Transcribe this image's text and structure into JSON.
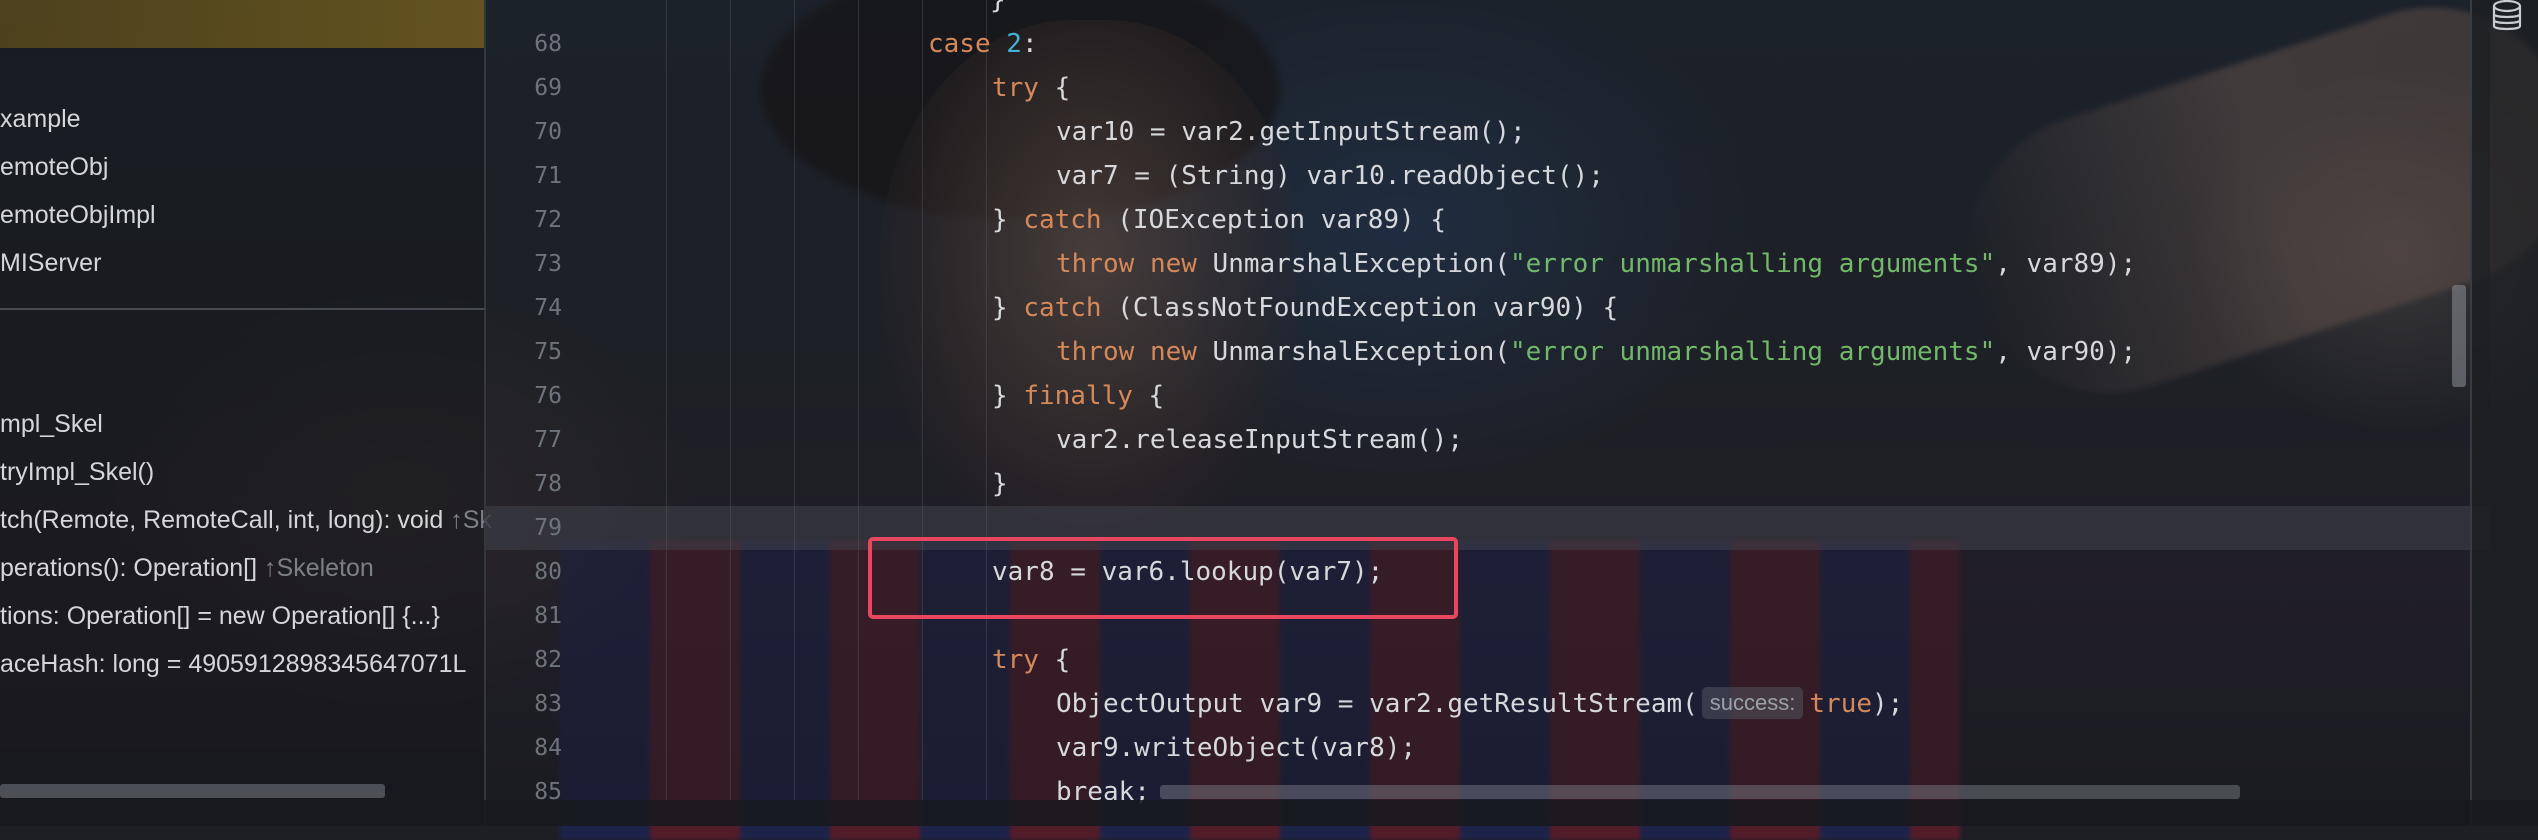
{
  "project_tree": {
    "items": [
      {
        "label": "xample"
      },
      {
        "label": "emoteObj"
      },
      {
        "label": "emoteObjImpl"
      },
      {
        "label": "MIServer"
      },
      {
        "label": "mpl_Skel"
      },
      {
        "label": "tryImpl_Skel()"
      },
      {
        "label": "tch(Remote, RemoteCall, int, long): void",
        "hint": "↑Sk"
      },
      {
        "label": "perations(): Operation[]",
        "hint": "↑Skeleton"
      },
      {
        "label": "tions: Operation[] = new Operation[] {...}"
      },
      {
        "label": "aceHash: long = 4905912898345647071L"
      }
    ]
  },
  "editor": {
    "line_numbers": [
      "68",
      "69",
      "70",
      "71",
      "72",
      "73",
      "74",
      "75",
      "76",
      "77",
      "78",
      "79",
      "80",
      "81",
      "82",
      "83",
      "84",
      "85"
    ],
    "code": {
      "l67_brace": "}",
      "l68_kw": "case ",
      "l68_num": "2",
      "l68_rest": ":",
      "l69_kw": "try",
      "l69_rest": " {",
      "l70": "var10 = var2.getInputStream();",
      "l71": "var7 = (String) var10.readObject();",
      "l72_a": "} ",
      "l72_kw": "catch",
      "l72_b": " (IOException var89) {",
      "l73_kw1": "throw",
      "l73_sp": " ",
      "l73_kw2": "new",
      "l73_a": " UnmarshalException(",
      "l73_str": "\"error unmarshalling arguments\"",
      "l73_b": ", var89);",
      "l74_a": "} ",
      "l74_kw": "catch",
      "l74_b": " (ClassNotFoundException var90) {",
      "l75_kw1": "throw",
      "l75_sp": " ",
      "l75_kw2": "new",
      "l75_a": " UnmarshalException(",
      "l75_str": "\"error unmarshalling arguments\"",
      "l75_b": ", var90);",
      "l76_a": "} ",
      "l76_kw": "finally",
      "l76_b": " {",
      "l77": "var2.releaseInputStream();",
      "l78": "}",
      "l80": "var8 = var6.lookup(var7);",
      "l82_kw": "try",
      "l82_rest": " {",
      "l83_a": "ObjectOutput var9 = var2.getResultStream(",
      "l83_hint": "success:",
      "l83_kw": "true",
      "l83_b": ");",
      "l84": "var9.writeObject(var8);",
      "l85": "break;"
    },
    "highlight_color": "#e8475f"
  },
  "icons": {
    "right_strip": "database-icon"
  },
  "colors": {
    "keyword": "#d5895a",
    "number": "#3fb4d6",
    "string": "#73b86a",
    "selection_highlight": "#9a7a20"
  }
}
